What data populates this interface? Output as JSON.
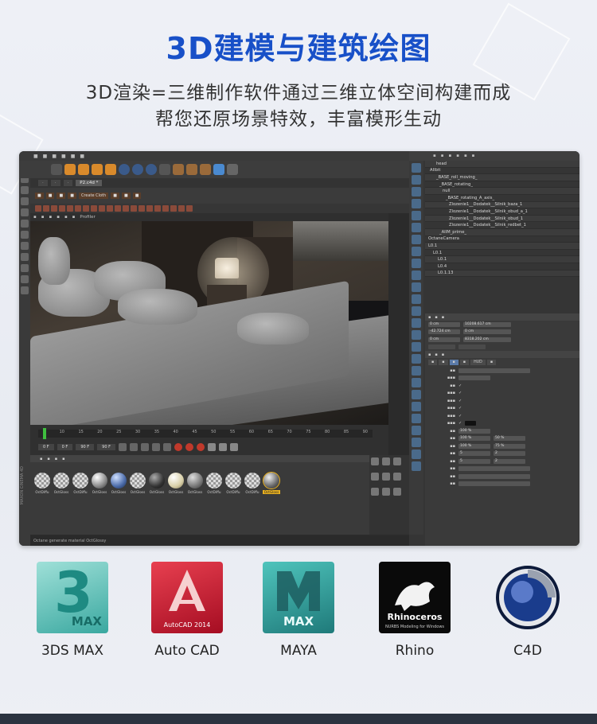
{
  "header": {
    "title": "3D建模与建筑绘图",
    "subtitle_line1": "3D渲染=三维制作软件通过三维立体空间构建而成",
    "subtitle_line2": "帮您还原场景特效，丰富模形生动"
  },
  "software": [
    {
      "name": "3DS MAX",
      "tile_text": "3",
      "tile_sub": "MAX",
      "color": "#3aa8a0"
    },
    {
      "name": "Auto CAD",
      "tile_text": "A",
      "tile_sub": "AutoCAD 2014",
      "color": "#c8102e"
    },
    {
      "name": "MAYA",
      "tile_text": "M",
      "tile_sub": "MAX",
      "color": "#2a8a8a"
    },
    {
      "name": "Rhino",
      "tile_text": "Rhinoceros",
      "tile_sub": "NURBS Modeling for Windows",
      "color": "#111111"
    },
    {
      "name": "C4D",
      "tile_text": "",
      "tile_sub": "",
      "color": "#1a3c8c"
    }
  ],
  "app": {
    "tabs": [
      "P2.c4d *"
    ],
    "toolbar_chips": [
      "Create Cloth"
    ],
    "viewport_menu": [
      "Profiler"
    ],
    "tree_rows": [
      "head",
      "AIIbit",
      "_BASE_roll_moving_",
      "_BASE_rotating_",
      "null",
      "_BASE_rotating_A_axis_",
      "Zlozenie1__Dodatek__Silnik_baza_1",
      "Zlozenie1__Dodatek__Silnik_obud_a_1",
      "Zlozenie1__Dodatek__Silnik_obud_1",
      "Zlozenie1__Dodatek__Silnik_redbet_1",
      "_AIIM_prime_",
      "OctaneCamera",
      "L0.1",
      "L0.1",
      "L0.1",
      "L0.4",
      "L0.1.13"
    ],
    "coords": {
      "row1": [
        "0 cm",
        "10208.617 cm"
      ],
      "row2": [
        "-42.724 cm",
        "0 cm"
      ],
      "row3": [
        "0 cm",
        "8318.202 cm"
      ]
    },
    "prop_tabs": [
      "HUD"
    ],
    "timeline_ticks": [
      "5",
      "10",
      "15",
      "20",
      "25",
      "30",
      "35",
      "40",
      "45",
      "50",
      "55",
      "60",
      "65",
      "70",
      "75",
      "80",
      "85",
      "90"
    ],
    "timeline_fields": [
      "0 F",
      "0 F",
      "90 F",
      "90 F"
    ],
    "materials": [
      "OctDiffu",
      "OctGloss",
      "OctDiffu",
      "OctGloss",
      "OctGloss",
      "OctGloss",
      "OctGloss",
      "OctGloss",
      "OctGloss",
      "OctDiffu",
      "OctDiffu",
      "OctDiffu",
      "OctGloss"
    ],
    "status_text": "Octane generate material OctGlossy",
    "side_label": "MAXON CINEMA 4D",
    "numeric_fields": [
      "100 %",
      "100 %",
      "100 %",
      "5",
      "5",
      "50 %",
      "75 %",
      "2",
      "2"
    ]
  }
}
